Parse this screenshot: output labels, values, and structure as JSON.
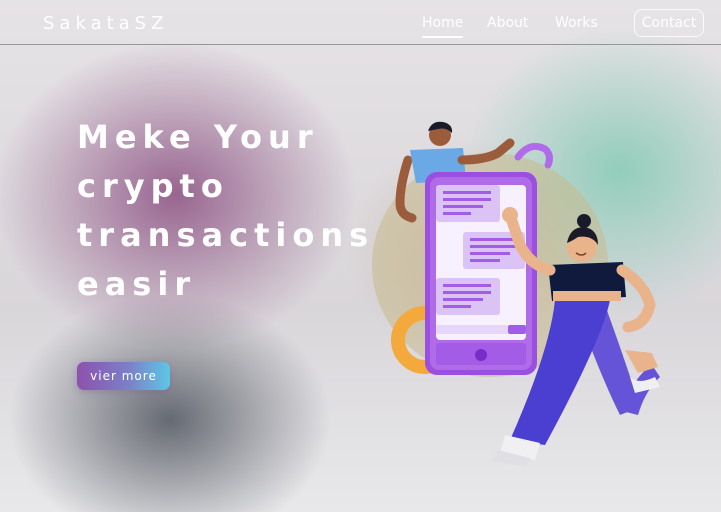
{
  "header": {
    "logo": "SakataSZ",
    "nav": {
      "home": "Home",
      "about": "About",
      "works": "Works"
    },
    "contact": "Contact"
  },
  "hero": {
    "lines": [
      "Meke Your",
      "crypto",
      "transactions",
      "easir"
    ],
    "button": "vier more"
  },
  "colors": {
    "phone": "#b06be8",
    "phone_dark": "#9a4fe0",
    "bubble": "#dcc3f6",
    "bubble_line": "#a35ce6",
    "woman_pants": "#4a3fd1",
    "woman_top": "#0f1a3d",
    "skin_light": "#e9b38c",
    "skin_dark": "#9b5c3c",
    "man_shirt": "#6aa8e6",
    "ring_orange": "#f3a93b"
  },
  "illustration": {
    "icons": [
      "phone-illustration",
      "woman-figure",
      "man-figure",
      "orange-ring"
    ]
  }
}
